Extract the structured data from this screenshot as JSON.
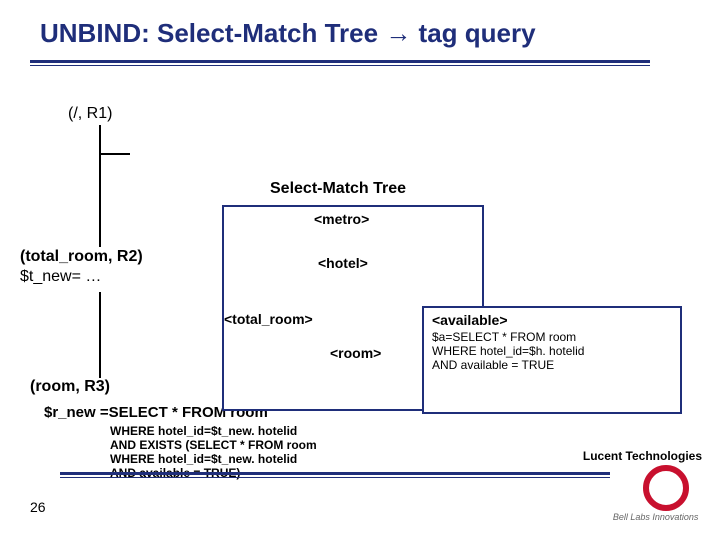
{
  "title": {
    "pre": "UNBIND: Select-Match Tree ",
    "arrow": "→",
    "post": " tag query"
  },
  "tree_label": "Select-Match Tree",
  "root": "(/, R1)",
  "total_room": {
    "label": "(total_room, R2)",
    "tnew": "$t_new= …"
  },
  "room_node": "(room, R3)",
  "r_new_head": "$r_new =SELECT * FROM room",
  "r_new_body": "WHERE hotel_id=$t_new. hotelid\nAND EXISTS (SELECT * FROM room\n                    WHERE hotel_id=$t_new. hotelid\n                    AND available = TRUE)",
  "tags": {
    "metro": "<metro>",
    "hotel": "<hotel>",
    "total_room": "<total_room>",
    "room": "<room>",
    "available": "<available>"
  },
  "avail_query": "$a=SELECT * FROM room\n      WHERE hotel_id=$h. hotelid\n      AND available = TRUE",
  "page": "26",
  "logo": {
    "name": "Lucent Technologies",
    "sub": "Bell Labs Innovations"
  }
}
